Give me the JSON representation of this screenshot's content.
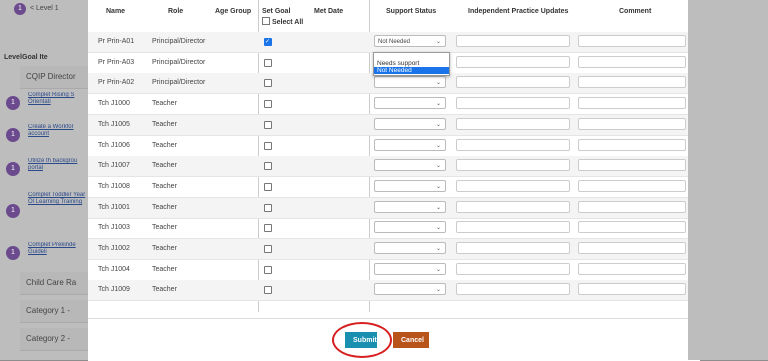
{
  "background": {
    "level_badge": "1",
    "level_label": "< Level 1",
    "col_level": "Level",
    "col_goal": "Goal Ite",
    "sections": [
      {
        "label": "CQIP Director"
      },
      {
        "label": "Child Care Ra"
      },
      {
        "label": "Category 1 -"
      },
      {
        "label": "Category 2 -"
      }
    ],
    "goals": [
      {
        "badge": "1",
        "text": "Complet Rising S Orientati"
      },
      {
        "badge": "1",
        "text": "Create a Workfor account"
      },
      {
        "badge": "1",
        "text": "Utilize th backgrou portal"
      },
      {
        "badge": "1",
        "text": "Complet Toddler Year Ol Learning Training"
      },
      {
        "badge": "1",
        "text": "Complet Prekinde Guideli"
      }
    ]
  },
  "table": {
    "headers": {
      "name": "Name",
      "role": "Role",
      "age_group": "Age Group",
      "set_goal": "Set Goal",
      "select_all": "Select All",
      "met_date": "Met Date",
      "support_status": "Support Status",
      "ip_updates": "Independent Practice Updates",
      "comment": "Comment"
    },
    "rows": [
      {
        "name": "Pr Prin-A01",
        "role": "Principal/Director",
        "checked": true,
        "status": "Not Needed"
      },
      {
        "name": "Pr Prin-A03",
        "role": "Principal/Director",
        "checked": false,
        "status": ""
      },
      {
        "name": "Pr Prin-A02",
        "role": "Principal/Director",
        "checked": false,
        "status": ""
      },
      {
        "name": "Tch J1000",
        "role": "Teacher",
        "checked": false,
        "status": ""
      },
      {
        "name": "Tch J1005",
        "role": "Teacher",
        "checked": false,
        "status": ""
      },
      {
        "name": "Tch J1006",
        "role": "Teacher",
        "checked": false,
        "status": ""
      },
      {
        "name": "Tch J1007",
        "role": "Teacher",
        "checked": false,
        "status": ""
      },
      {
        "name": "Tch J1008",
        "role": "Teacher",
        "checked": false,
        "status": ""
      },
      {
        "name": "Tch J1001",
        "role": "Teacher",
        "checked": false,
        "status": ""
      },
      {
        "name": "Tch J1003",
        "role": "Teacher",
        "checked": false,
        "status": ""
      },
      {
        "name": "Tch J1002",
        "role": "Teacher",
        "checked": false,
        "status": ""
      },
      {
        "name": "Tch J1004",
        "role": "Teacher",
        "checked": false,
        "status": ""
      },
      {
        "name": "Tch J1009",
        "role": "Teacher",
        "checked": false,
        "status": ""
      }
    ]
  },
  "dropdown": {
    "options": [
      "",
      "Needs support",
      "Not Needed"
    ],
    "selected": "Not Needed"
  },
  "footer": {
    "submit_label": "Submit",
    "cancel_label": "Cancel"
  },
  "colors": {
    "submit": "#1b8fb0",
    "cancel": "#b8541a",
    "highlight_circle": "#d81e1e",
    "checkbox_checked": "#1a73e8"
  }
}
